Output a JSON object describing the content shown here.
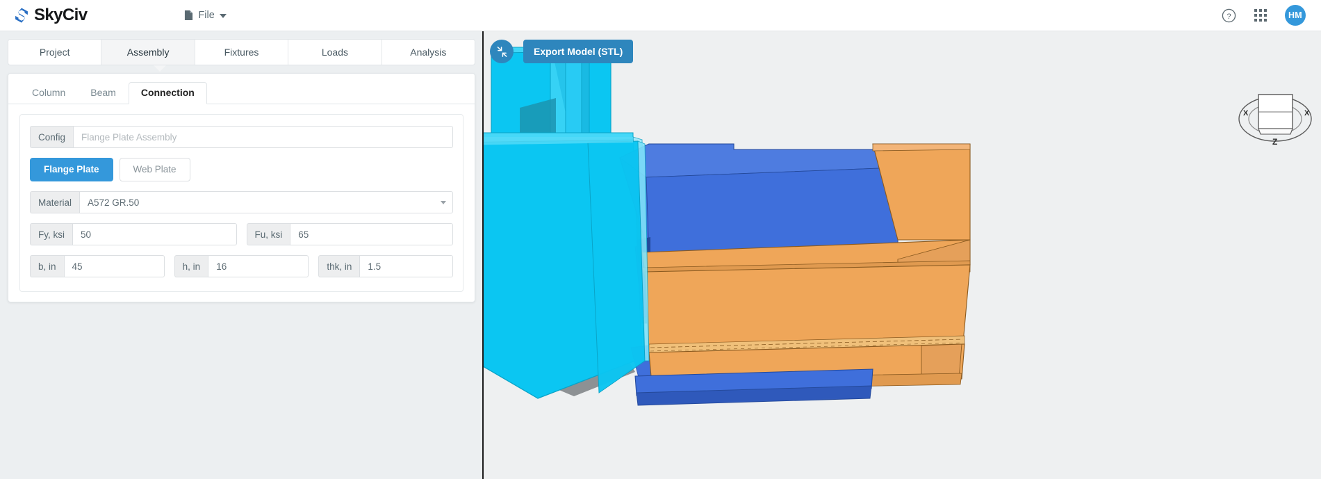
{
  "app": {
    "brand": "SkyCiv",
    "brand_mark_color": "#2a6fc4",
    "accent_color": "#3498db",
    "viewport_bg": "#eef0f1",
    "panel_bg": "#eceff1"
  },
  "topbar": {
    "file_menu_label": "File",
    "file_icon": "file-document-icon",
    "caret_icon": "chevron-down-icon",
    "help_icon": "question-circle-icon",
    "apps_icon": "grid-apps-icon",
    "avatar_initials": "HM"
  },
  "main_tabs": [
    {
      "label": "Project",
      "active": false
    },
    {
      "label": "Assembly",
      "active": true
    },
    {
      "label": "Fixtures",
      "active": false
    },
    {
      "label": "Loads",
      "active": false
    },
    {
      "label": "Analysis",
      "active": false
    }
  ],
  "sub_tabs": [
    {
      "label": "Column",
      "active": false
    },
    {
      "label": "Beam",
      "active": false
    },
    {
      "label": "Connection",
      "active": true
    }
  ],
  "form": {
    "config": {
      "label": "Config",
      "value": "Flange Plate Assembly",
      "is_placeholder": true
    },
    "plate_toggle": [
      {
        "label": "Flange Plate",
        "active": true
      },
      {
        "label": "Web Plate",
        "active": false
      }
    ],
    "material": {
      "label": "Material",
      "value": "A572 GR.50",
      "caret_icon": "chevron-down-icon"
    },
    "fy": {
      "label": "Fy, ksi",
      "value": "50"
    },
    "fu": {
      "label": "Fu, ksi",
      "value": "65"
    },
    "b": {
      "label": "b, in",
      "value": "45"
    },
    "h": {
      "label": "h, in",
      "value": "16"
    },
    "thk": {
      "label": "thk, in",
      "value": "1.5"
    }
  },
  "viewport": {
    "fullscreen_icon": "compress-arrows-icon",
    "export_button_label": "Export Model (STL)",
    "viewcube": {
      "icon": "view-orientation-cube-icon",
      "axis_left": "X",
      "axis_right": "X",
      "axis_bottom": "Z"
    },
    "model": {
      "description": "3D steel moment connection: cyan I-section column, orange I-section beam, blue flange plates",
      "column_color": "#0cc8f5",
      "beam_color": "#efa659",
      "plate_color": "#3f6fdb",
      "shadow_color": "#8d9194"
    }
  }
}
